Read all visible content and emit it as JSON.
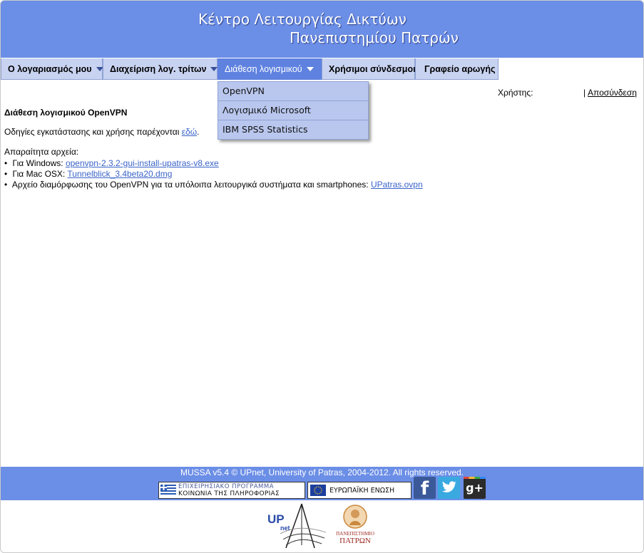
{
  "header": {
    "title_line1": "Κέντρο Λειτουργίας Δικτύων",
    "title_line2": "Πανεπιστημίου Πατρών"
  },
  "nav": {
    "items": [
      {
        "label": "Ο λογαριασμός μου",
        "has_dropdown": true
      },
      {
        "label": "Διαχείριση λογ. τρίτων",
        "has_dropdown": true
      },
      {
        "label": "Διάθεση λογισμικού",
        "has_dropdown": true,
        "active": true
      },
      {
        "label": "Χρήσιμοι σύνδεσμοι",
        "has_dropdown": false
      },
      {
        "label": "Γραφείο αρωγής",
        "has_dropdown": false
      }
    ],
    "dropdown": [
      "OpenVPN",
      "Λογισμικό Microsoft",
      "IBM SPSS Statistics"
    ]
  },
  "userbar": {
    "user_label": "Χρήστης:",
    "separator": "|",
    "logout": "Αποσύνδεση"
  },
  "content": {
    "heading": "Διάθεση λογισμικού OpenVPN",
    "instructions_text": "Οδηγίες εγκατάστασης και χρήσης παρέχονται",
    "instructions_link": "εδώ",
    "instructions_end": ".",
    "files_label": "Απαραίτητα αρχεία:",
    "files": [
      {
        "prefix": "Για Windows:",
        "link": "openvpn-2.3.2-gui-install-upatras-v8.exe"
      },
      {
        "prefix": "Για Mac OSX:",
        "link": "Tunnelblick_3.4beta20.dmg"
      },
      {
        "prefix": "Αρχείο διαμόρφωσης του OpenVPN για τα υπόλοιπα λειτουργικά συστήματα και smartphones:",
        "link": "UPatras.ovpn"
      }
    ]
  },
  "footer": {
    "copyright": "MUSSA v5.4 © UPnet, University of Patras, 2004-2012. All rights reserved.",
    "logo1_line1": "ΕΠΙΧΕΙΡΗΣΙΑΚΟ ΠΡΟΓΡΑΜΜΑ",
    "logo1_line2": "ΚΟΙΝΩΝΙΑ ΤΗΣ ΠΛΗΡΟΦΟΡΙΑΣ",
    "logo2": "ΕΥΡΩΠΑΪΚΗ ΕΝΩΣΗ",
    "social": [
      "facebook-icon",
      "twitter-icon",
      "google-plus-icon"
    ],
    "facebook_glyph": "f",
    "google_glyph": "g+"
  },
  "bottom_logos": {
    "upnet_text": "UP",
    "upnet_sub": "net",
    "univ_line1": "ΠΑΝΕΠΙΣΤΗΜΙΟ",
    "univ_line2": "ΠΑΤΡΩΝ"
  },
  "colors": {
    "header_blue": "#6b8ee6",
    "nav_bg": "#c8d3f1",
    "nav_active": "#5f82e0",
    "link": "#3a64c8"
  }
}
